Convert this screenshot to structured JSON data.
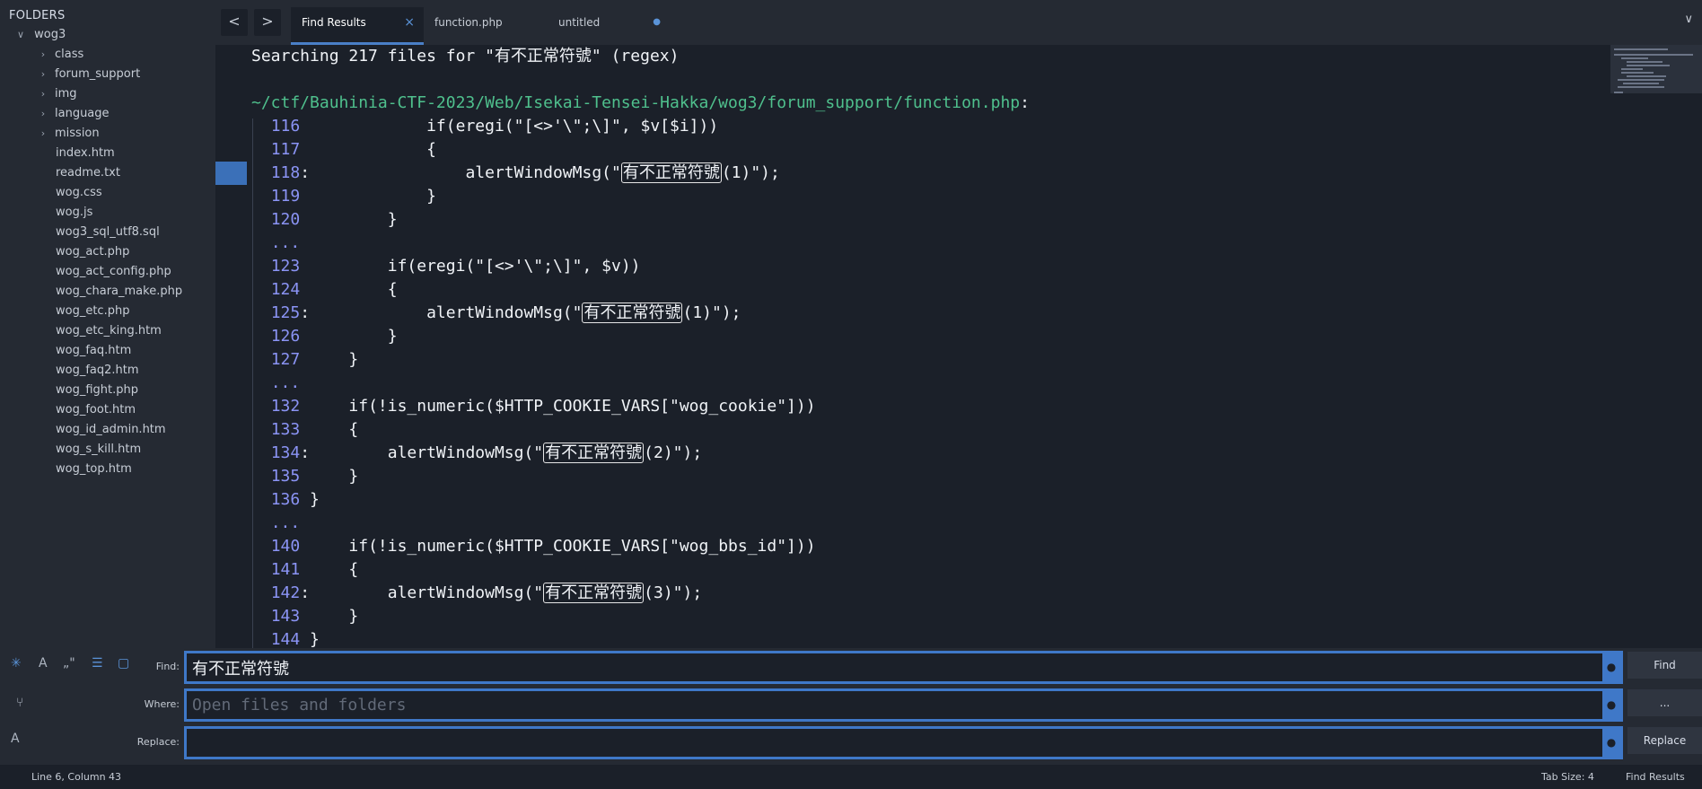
{
  "sidebar": {
    "header": "FOLDERS",
    "root": "wog3",
    "folders": [
      "class",
      "forum_support",
      "img",
      "language",
      "mission"
    ],
    "files": [
      "index.htm",
      "readme.txt",
      "wog.css",
      "wog.js",
      "wog3_sql_utf8.sql",
      "wog_act.php",
      "wog_act_config.php",
      "wog_chara_make.php",
      "wog_etc.php",
      "wog_etc_king.htm",
      "wog_faq.htm",
      "wog_faq2.htm",
      "wog_fight.php",
      "wog_foot.htm",
      "wog_id_admin.htm",
      "wog_s_kill.htm",
      "wog_top.htm"
    ]
  },
  "tabs": {
    "back": "<",
    "forward": ">",
    "items": [
      {
        "label": "Find Results",
        "close": "×"
      },
      {
        "label": "function.php"
      },
      {
        "label": "untitled",
        "dirty": "●"
      }
    ],
    "menu": "∨"
  },
  "editor": {
    "header": "Searching 217 files for \"有不正常符號\" (regex)",
    "path": "~/ctf/Bauhinia-CTF-2023/Web/Isekai-Tensei-Hakka/wog3/forum_support/function.php",
    "path_suffix": ":",
    "lines": [
      {
        "ln": "116",
        "sep": " ",
        "code": "            if(eregi(\"[<>'\\\";\\]\", $v[$i]))"
      },
      {
        "ln": "117",
        "sep": " ",
        "code": "            {"
      },
      {
        "ln": "118",
        "sep": ":",
        "pre": "                alertWindowMsg(\"",
        "match": "有不正常符號",
        "post": "(1)\");"
      },
      {
        "ln": "119",
        "sep": " ",
        "code": "            }"
      },
      {
        "ln": "120",
        "sep": " ",
        "code": "        }"
      },
      {
        "ln": "...",
        "sep": "",
        "code": ""
      },
      {
        "ln": "123",
        "sep": " ",
        "code": "        if(eregi(\"[<>'\\\";\\]\", $v))"
      },
      {
        "ln": "124",
        "sep": " ",
        "code": "        {"
      },
      {
        "ln": "125",
        "sep": ":",
        "pre": "            alertWindowMsg(\"",
        "match": "有不正常符號",
        "post": "(1)\");"
      },
      {
        "ln": "126",
        "sep": " ",
        "code": "        }"
      },
      {
        "ln": "127",
        "sep": " ",
        "code": "    }"
      },
      {
        "ln": "...",
        "sep": "",
        "code": ""
      },
      {
        "ln": "132",
        "sep": " ",
        "code": "    if(!is_numeric($HTTP_COOKIE_VARS[\"wog_cookie\"]))"
      },
      {
        "ln": "133",
        "sep": " ",
        "code": "    {"
      },
      {
        "ln": "134",
        "sep": ":",
        "pre": "        alertWindowMsg(\"",
        "match": "有不正常符號",
        "post": "(2)\");"
      },
      {
        "ln": "135",
        "sep": " ",
        "code": "    }"
      },
      {
        "ln": "136",
        "sep": " ",
        "code": "}"
      },
      {
        "ln": "...",
        "sep": "",
        "code": ""
      },
      {
        "ln": "140",
        "sep": " ",
        "code": "    if(!is_numeric($HTTP_COOKIE_VARS[\"wog_bbs_id\"]))"
      },
      {
        "ln": "141",
        "sep": " ",
        "code": "    {"
      },
      {
        "ln": "142",
        "sep": ":",
        "pre": "        alertWindowMsg(\"",
        "match": "有不正常符號",
        "post": "(3)\");"
      },
      {
        "ln": "143",
        "sep": " ",
        "code": "    }"
      },
      {
        "ln": "144",
        "sep": " ",
        "code": "}"
      }
    ]
  },
  "find_panel": {
    "find_label": "Find:",
    "find_value": "有不正常符號",
    "where_label": "Where:",
    "where_placeholder": "Open files and folders",
    "replace_label": "Replace:",
    "replace_value": "",
    "find_button": "Find",
    "where_button": "...",
    "replace_button": "Replace",
    "field_dot": "●",
    "icons": {
      "regex": "✳",
      "case": "A",
      "whole_word": "„\"",
      "in_selection": "☰",
      "highlight": "▢",
      "branch": "⑂",
      "preserve_case": "A"
    }
  },
  "status": {
    "position": "Line 6, Column 43",
    "tab_size": "Tab Size: 4",
    "syntax": "Find Results"
  },
  "colors": {
    "accent": "#3f78c8",
    "line_number": "#8b94f5",
    "path": "#4fc08d"
  }
}
